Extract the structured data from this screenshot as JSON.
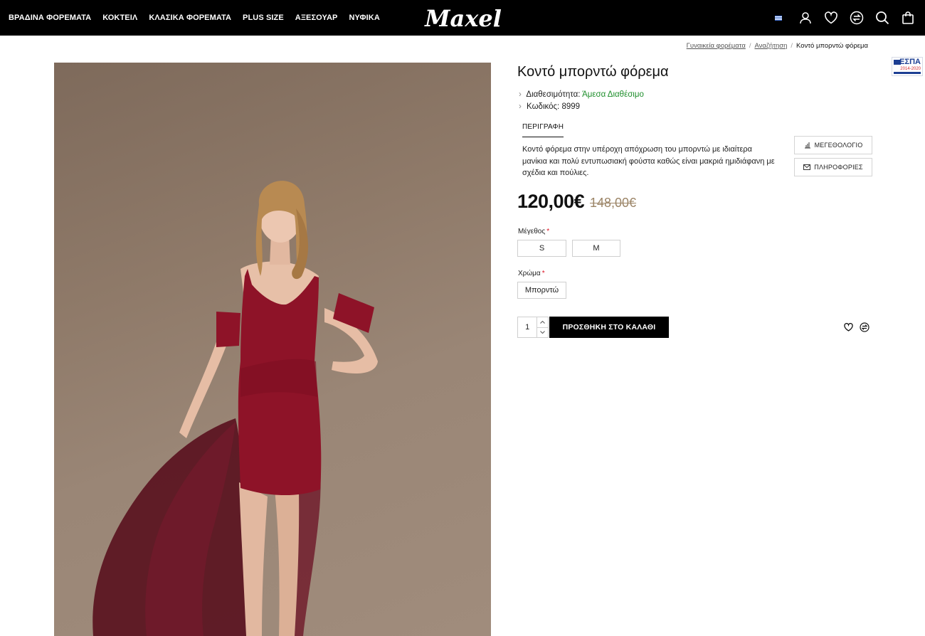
{
  "header": {
    "nav": [
      "ΒΡΑΔΙΝΑ ΦΟΡΕΜΑΤΑ",
      "ΚΟΚΤΕΙΛ",
      "ΚΛΑΣΙΚΑ ΦΟΡΕΜΑΤΑ",
      "PLUS SIZE",
      "ΑΞΕΣΟΥΑΡ",
      "ΝΥΦΙΚΑ"
    ],
    "logo_text": "Maxel",
    "icons": [
      "language-flag-icon",
      "account-icon",
      "wishlist-heart-icon",
      "compare-icon",
      "search-icon",
      "cart-bag-icon"
    ]
  },
  "breadcrumb": {
    "items": [
      "Γυναικεία φορέματα",
      "Αναζήτηση"
    ],
    "current": "Κοντό μπορντώ φόρεμα"
  },
  "espa": {
    "title": "ΕΣΠΑ",
    "years": "2014-2020"
  },
  "product": {
    "title": "Κοντό μπορντώ φόρεμα",
    "availability_label": "Διαθεσιμότητα:",
    "availability_value": "Άμεσα Διαθέσιμο",
    "code_label": "Κωδικός:",
    "code_value": "8999",
    "description_tab": "ΠΕΡΙΓΡΑΦΗ",
    "description": "Κοντό φόρεμα στην υπέροχη απόχρωση του μπορντώ με ιδιαίτερα μανίκια και πολύ εντυπωσιακή φούστα καθώς είναι μακριά ημιδιάφανη με σχέδια και πούλιες.",
    "size_chart_button": "ΜΕΓΕΘΟΛΟΓΙΟ",
    "info_button": "ΠΛΗΡΟΦΟΡΙΕΣ",
    "price": "120,00€",
    "old_price": "148,00€",
    "size_label": "Μέγεθος",
    "sizes": [
      "S",
      "M"
    ],
    "color_label": "Χρώμα",
    "colors": [
      "Μπορντώ"
    ],
    "required_mark": "*",
    "quantity": "1",
    "add_to_cart": "ΠΡΟΣΘΗΚΗ ΣΤΟ ΚΑΛΑΘΙ",
    "image_icon": "product-photo-model-burgundy-dress"
  },
  "colors": {
    "header_bg": "#000000",
    "availability": "#1f8f2c",
    "old_price": "#9b8466",
    "dress": "#8e1328"
  }
}
